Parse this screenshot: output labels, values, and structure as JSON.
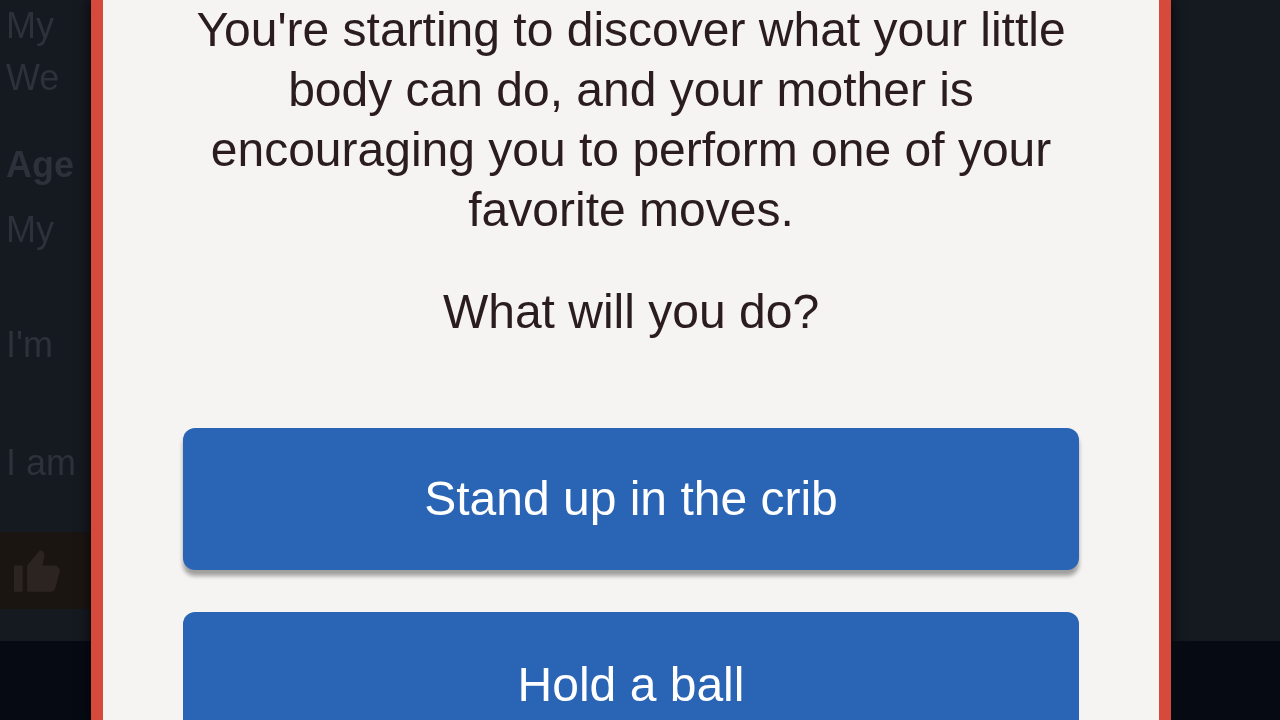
{
  "background": {
    "lines": [
      {
        "text": "My",
        "kind": "body"
      },
      {
        "text": "We",
        "kind": "body"
      },
      {
        "text": "Age",
        "kind": "heading"
      },
      {
        "text": "My",
        "kind": "body"
      },
      {
        "text": "I'm",
        "kind": "body"
      },
      {
        "text": "I am",
        "kind": "body"
      }
    ]
  },
  "dialog": {
    "story": "You're starting to discover what your little body can do, and your mother is encouraging you to perform one of your favorite moves.",
    "question": "What will you do?",
    "choices": [
      "Stand up in the crib",
      "Hold a ball"
    ]
  }
}
